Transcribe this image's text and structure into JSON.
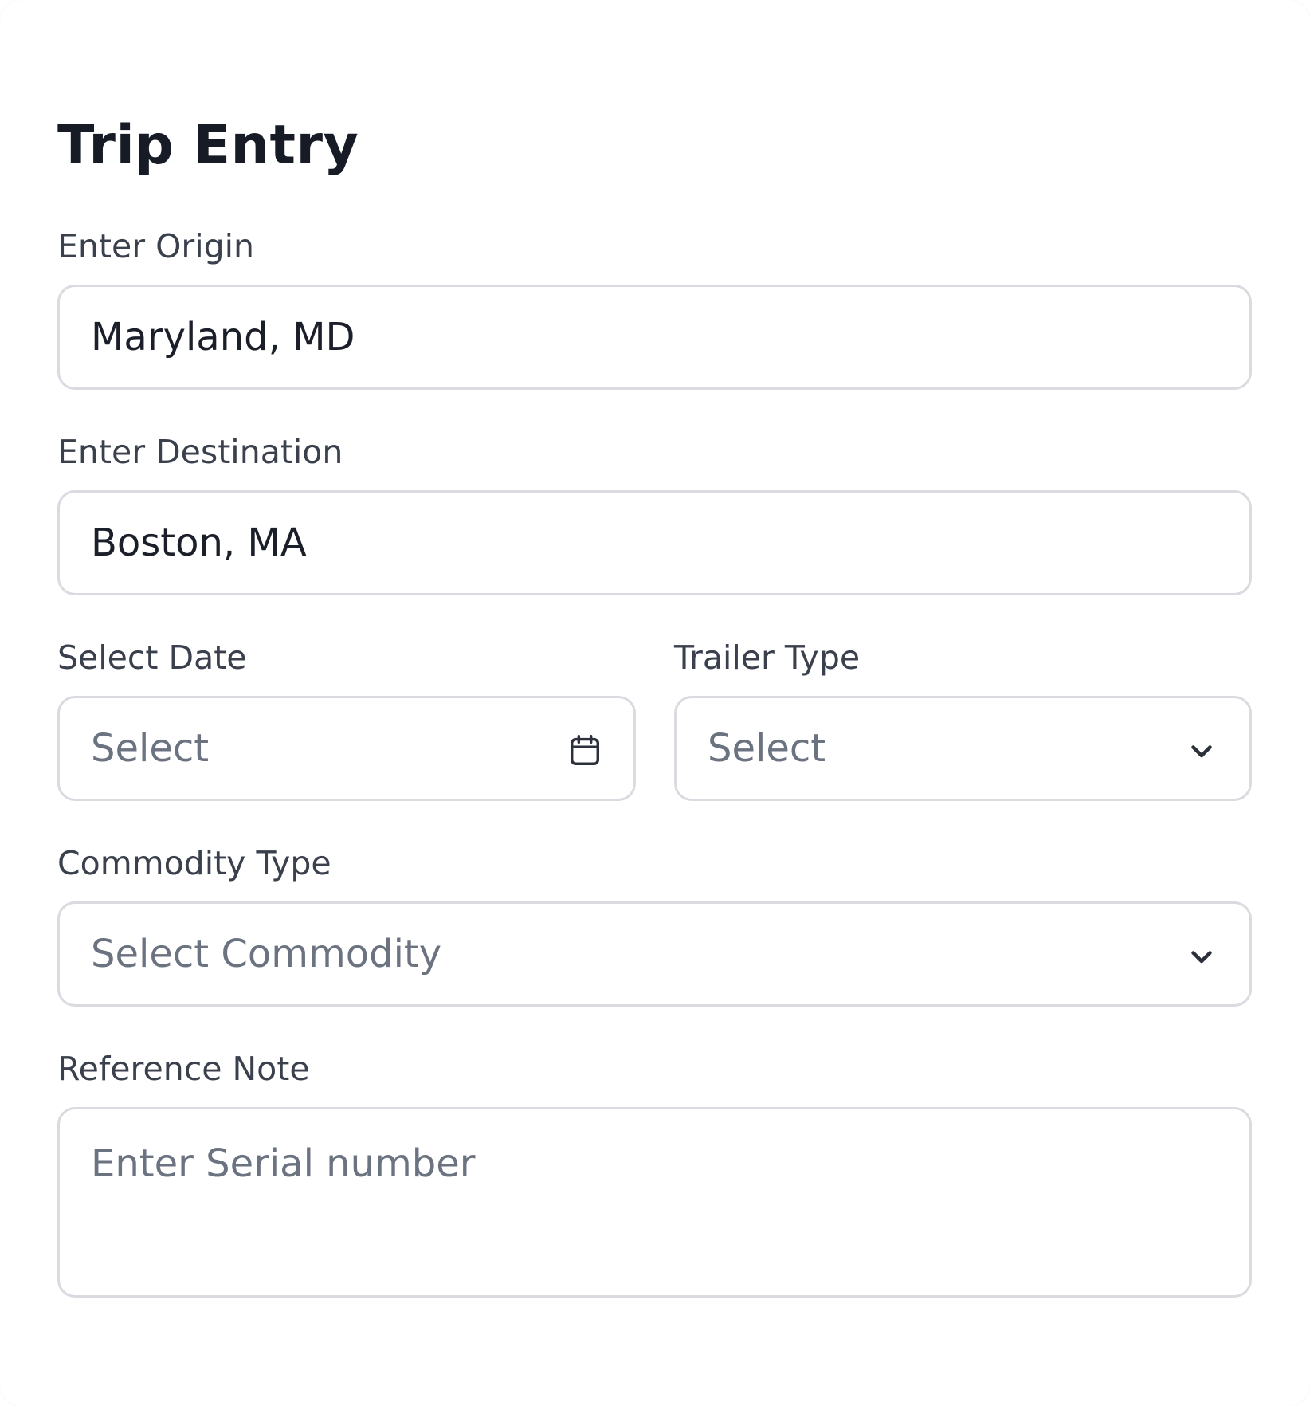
{
  "form": {
    "title": "Trip Entry",
    "origin": {
      "label": "Enter Origin",
      "value": "Maryland, MD"
    },
    "destination": {
      "label": "Enter Destination",
      "value": "Boston, MA"
    },
    "date": {
      "label": "Select Date",
      "placeholder": "Select",
      "icon": "calendar-icon"
    },
    "trailer_type": {
      "label": "Trailer Type",
      "placeholder": "Select",
      "icon": "chevron-down-icon"
    },
    "commodity_type": {
      "label": "Commodity Type",
      "placeholder": "Select Commodity",
      "icon": "chevron-down-icon"
    },
    "reference_note": {
      "label": "Reference Note",
      "placeholder": "Enter Serial number"
    }
  },
  "colors": {
    "title": "#161b26",
    "label": "#3a404c",
    "value": "#1b1f29",
    "placeholder": "#6b7280",
    "border": "#d9dbe0",
    "icon": "#2b303b"
  }
}
